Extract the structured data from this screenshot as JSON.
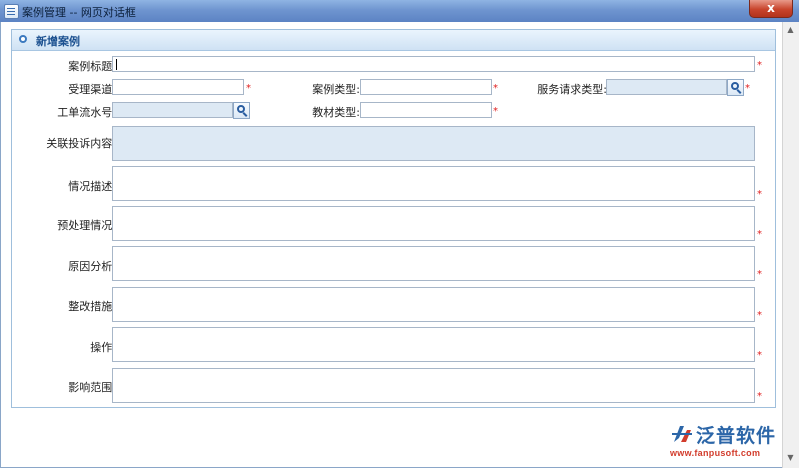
{
  "window": {
    "title": "案例管理 -- 网页对话框",
    "close_label": "x"
  },
  "panel": {
    "title": "新增案例"
  },
  "form": {
    "case_title": {
      "label": "案例标题:",
      "value": ""
    },
    "accept_channel": {
      "label": "受理渠道:",
      "value": ""
    },
    "case_type": {
      "label": "案例类型:",
      "value": ""
    },
    "service_request_type": {
      "label": "服务请求类型:",
      "value": ""
    },
    "work_order_no": {
      "label": "工单流水号:",
      "value": ""
    },
    "material_type": {
      "label": "教材类型:",
      "value": ""
    },
    "related_complaint": {
      "label": "关联投诉内容:"
    },
    "situation": {
      "label": "情况描述:"
    },
    "pre_handling": {
      "label": "预处理情况:"
    },
    "cause_analysis": {
      "label": "原因分析:"
    },
    "rectification": {
      "label": "整改措施:"
    },
    "operation": {
      "label": "操作:"
    },
    "impact_scope": {
      "label": "影响范围:"
    },
    "required_mark": "*"
  },
  "logo": {
    "brand": "泛普软件",
    "site": "www.fanpusoft.com"
  },
  "colors": {
    "required": "#e02020",
    "readonly_bg": "#dde9f4",
    "brand": "#2c66a8"
  }
}
